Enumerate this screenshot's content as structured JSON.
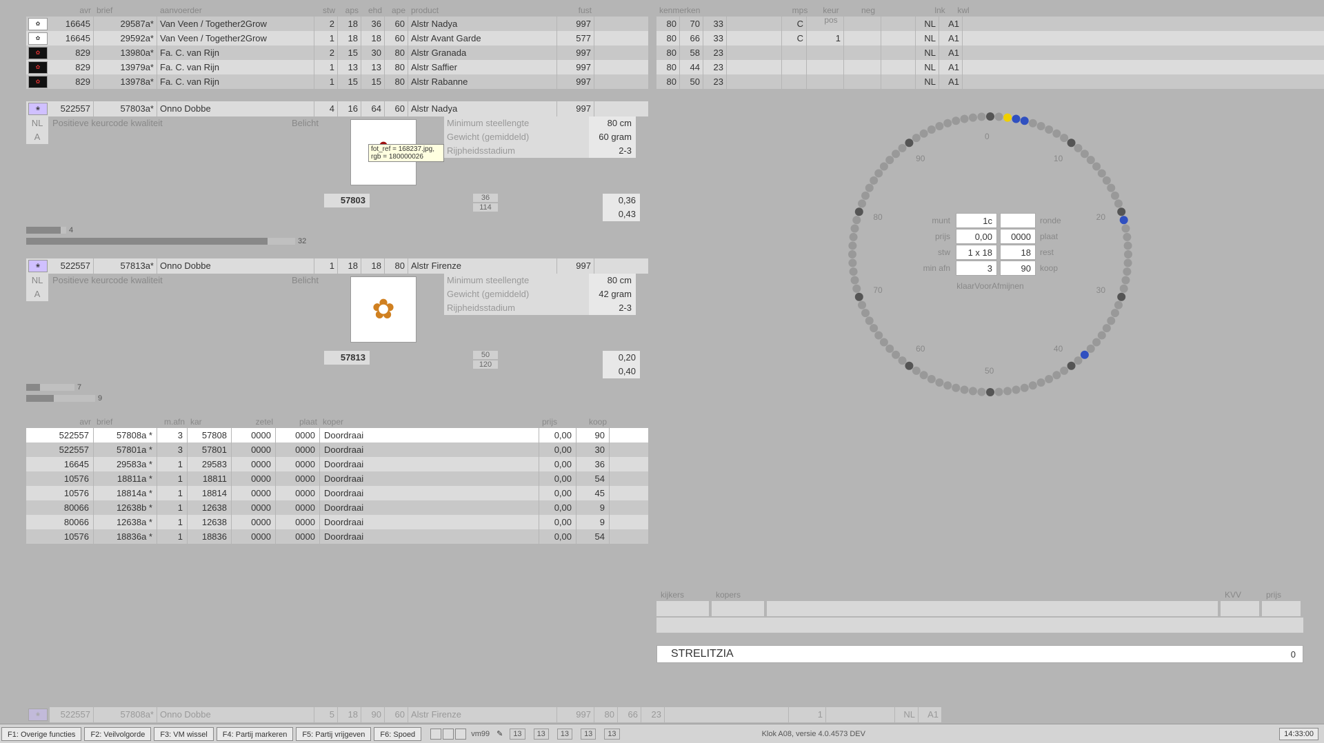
{
  "headers": {
    "avr": "avr",
    "brief": "brief",
    "aanvoerder": "aanvoerder",
    "stw": "stw",
    "aps": "aps",
    "ehd": "ehd",
    "ape": "ape",
    "product": "product",
    "fust": "fust",
    "kenmerken": "kenmerken",
    "mps": "mps",
    "keurpos": "keur pos",
    "neg": "neg",
    "land": "lnk",
    "kwl": "kwl"
  },
  "top_rows": [
    {
      "icon": "v",
      "avr": "16645",
      "brief": "29587a*",
      "aan": "Van Veen / Together2Grow",
      "stw": "2",
      "aps": "18",
      "ehd": "36",
      "ape": "60",
      "prod": "Alstr Nadya",
      "fust": "997",
      "k1": "80",
      "k2": "70",
      "k3": "33",
      "mps": "C",
      "kpos": "",
      "neg": "",
      "land": "NL",
      "kwl": "A1"
    },
    {
      "icon": "v",
      "avr": "16645",
      "brief": "29592a*",
      "aan": "Van Veen / Together2Grow",
      "stw": "1",
      "aps": "18",
      "ehd": "18",
      "ape": "60",
      "prod": "Alstr Avant Garde",
      "fust": "577",
      "k1": "80",
      "k2": "66",
      "k3": "33",
      "mps": "C",
      "kpos": "1",
      "neg": "",
      "land": "NL",
      "kwl": "A1"
    },
    {
      "icon": "r",
      "avr": "829",
      "brief": "13980a*",
      "aan": "Fa. C. van Rijn",
      "stw": "2",
      "aps": "15",
      "ehd": "30",
      "ape": "80",
      "prod": "Alstr Granada",
      "fust": "997",
      "k1": "80",
      "k2": "58",
      "k3": "23",
      "mps": "",
      "kpos": "",
      "neg": "",
      "land": "NL",
      "kwl": "A1"
    },
    {
      "icon": "r",
      "avr": "829",
      "brief": "13979a*",
      "aan": "Fa. C. van Rijn",
      "stw": "1",
      "aps": "13",
      "ehd": "13",
      "ape": "80",
      "prod": "Alstr Saffier",
      "fust": "997",
      "k1": "80",
      "k2": "44",
      "k3": "23",
      "mps": "",
      "kpos": "",
      "neg": "",
      "land": "NL",
      "kwl": "A1"
    },
    {
      "icon": "r",
      "avr": "829",
      "brief": "13978a*",
      "aan": "Fa. C. van Rijn",
      "stw": "1",
      "aps": "15",
      "ehd": "15",
      "ape": "80",
      "prod": "Alstr Rabanne",
      "fust": "997",
      "k1": "80",
      "k2": "50",
      "k3": "23",
      "mps": "",
      "kpos": "",
      "neg": "",
      "land": "NL",
      "kwl": "A1"
    }
  ],
  "detail1": {
    "avr": "522557",
    "brief": "57803a*",
    "aan": "Onno Dobbe",
    "stw": "4",
    "aps": "16",
    "ehd": "64",
    "ape": "60",
    "prod": "Alstr Nadya",
    "fust": "997",
    "land": "NL",
    "kwal": "A",
    "quality": "Positieve keurcode kwaliteit",
    "belicht": "Belicht",
    "attrs": [
      [
        "Minimum steellengte",
        "80 cm"
      ],
      [
        "Gewicht (gemiddeld)",
        "60 gram"
      ],
      [
        "Rijpheidsstadium",
        "2-3"
      ]
    ],
    "tooltip": "fot_ref = 168237.jpg, rgb = 180000026",
    "index": "57803",
    "mini": [
      "36",
      "114"
    ],
    "prices": [
      "0,36",
      "0,43"
    ],
    "bars": [
      {
        "fill": 50,
        "track": 58,
        "num": "4"
      },
      {
        "fill": 350,
        "track": 390,
        "num": "32"
      }
    ]
  },
  "detail2": {
    "avr": "522557",
    "brief": "57813a*",
    "aan": "Onno Dobbe",
    "stw": "1",
    "aps": "18",
    "ehd": "18",
    "ape": "80",
    "prod": "Alstr Firenze",
    "fust": "997",
    "land": "NL",
    "kwal": "A",
    "quality": "Positieve keurcode kwaliteit",
    "belicht": "Belicht",
    "attrs": [
      [
        "Minimum steellengte",
        "80 cm"
      ],
      [
        "Gewicht (gemiddeld)",
        "42 gram"
      ],
      [
        "Rijpheidsstadium",
        "2-3"
      ]
    ],
    "index": "57813",
    "mini": [
      "50",
      "120"
    ],
    "prices": [
      "0,20",
      "0,40"
    ],
    "bars": [
      {
        "fill": 20,
        "track": 70,
        "num": "7"
      },
      {
        "fill": 40,
        "track": 100,
        "num": "9"
      }
    ]
  },
  "trans_head": {
    "avr": "avr",
    "brief": "brief",
    "mafn": "m.afn",
    "kar": "kar",
    "zetel": "zetel",
    "plaat": "plaat",
    "koper": "koper",
    "prijs": "prijs",
    "koop": "koop"
  },
  "trans": [
    {
      "avr": "522557",
      "brief": "57808a *",
      "mafn": "3",
      "kar": "57808",
      "zetel": "0000",
      "plaat": "0000",
      "koper": "Doordraai",
      "prijs": "0,00",
      "koop": "90",
      "cls": "white"
    },
    {
      "avr": "522557",
      "brief": "57801a *",
      "mafn": "3",
      "kar": "57801",
      "zetel": "0000",
      "plaat": "0000",
      "koper": "Doordraai",
      "prijs": "0,00",
      "koop": "30",
      "cls": "dark"
    },
    {
      "avr": "16645",
      "brief": "29583a *",
      "mafn": "1",
      "kar": "29583",
      "zetel": "0000",
      "plaat": "0000",
      "koper": "Doordraai",
      "prijs": "0,00",
      "koop": "36",
      "cls": "light"
    },
    {
      "avr": "10576",
      "brief": "18811a *",
      "mafn": "1",
      "kar": "18811",
      "zetel": "0000",
      "plaat": "0000",
      "koper": "Doordraai",
      "prijs": "0,00",
      "koop": "54",
      "cls": "dark"
    },
    {
      "avr": "10576",
      "brief": "18814a *",
      "mafn": "1",
      "kar": "18814",
      "zetel": "0000",
      "plaat": "0000",
      "koper": "Doordraai",
      "prijs": "0,00",
      "koop": "45",
      "cls": "light"
    },
    {
      "avr": "80066",
      "brief": "12638b *",
      "mafn": "1",
      "kar": "12638",
      "zetel": "0000",
      "plaat": "0000",
      "koper": "Doordraai",
      "prijs": "0,00",
      "koop": "9",
      "cls": "dark"
    },
    {
      "avr": "80066",
      "brief": "12638a *",
      "mafn": "1",
      "kar": "12638",
      "zetel": "0000",
      "plaat": "0000",
      "koper": "Doordraai",
      "prijs": "0,00",
      "koop": "9",
      "cls": "light"
    },
    {
      "avr": "10576",
      "brief": "18836a *",
      "mafn": "1",
      "kar": "18836",
      "zetel": "0000",
      "plaat": "0000",
      "koper": "Doordraai",
      "prijs": "0,00",
      "koop": "54",
      "cls": "dark"
    }
  ],
  "footer_lot": {
    "avr": "522557",
    "brief": "57808a*",
    "aan": "Onno Dobbe",
    "stw": "5",
    "aps": "18",
    "ehd": "90",
    "ape": "60",
    "prod": "Alstr Firenze",
    "fust": "997",
    "k1": "80",
    "k2": "66",
    "k3": "23",
    "kpos": "1",
    "land": "NL",
    "kwl": "A1"
  },
  "clock": {
    "labels": {
      "munt": "munt",
      "prijs": "prijs",
      "stw": "stw",
      "minafn": "min afn",
      "ronde": "ronde",
      "plaat": "plaat",
      "rest": "rest",
      "koop": "koop"
    },
    "vals": {
      "munt": "1c",
      "prijs": "0,00",
      "stw": "1 x 18",
      "minafn": "3",
      "ronde": "",
      "plaat": "0000",
      "rest": "18",
      "koop": "90"
    },
    "status": "klaarVoorAfmijnen",
    "ticks": [
      "0",
      "10",
      "20",
      "30",
      "40",
      "50",
      "60",
      "70",
      "80",
      "90"
    ]
  },
  "br_head": {
    "kijkers": "kijkers",
    "kopers": "kopers",
    "kvv": "KVV",
    "prijs": "prijs"
  },
  "ticker": {
    "text": "STRELITZIA",
    "num": "0"
  },
  "fkeys": [
    "F1: Overige functies",
    "F2: Veilvolgorde",
    "F3: VM wissel",
    "F4: Partij markeren",
    "F5: Partij vrijgeven",
    "F6: Spoed"
  ],
  "status": {
    "vm": "vm99",
    "nums": [
      "13",
      "13",
      "13",
      "13",
      "13"
    ],
    "version": "Klok A08, versie 4.0.4573 DEV",
    "time": "14:33:00"
  }
}
